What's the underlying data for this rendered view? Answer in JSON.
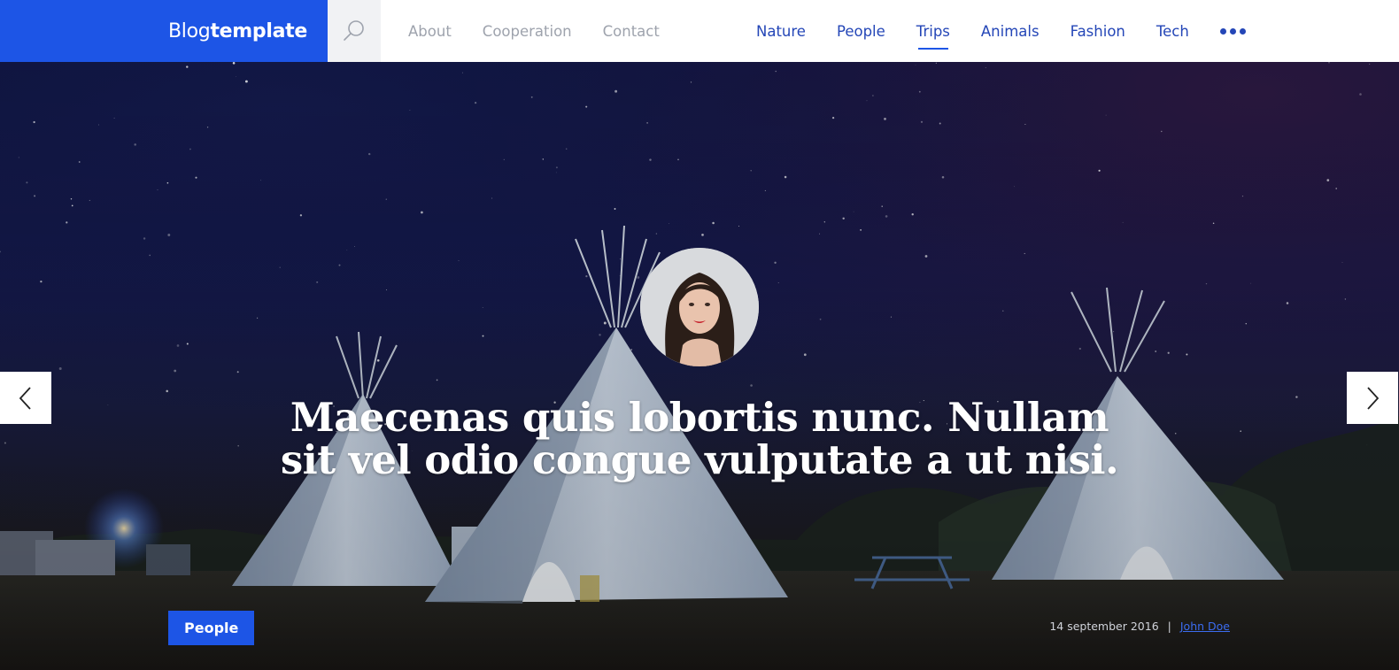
{
  "header": {
    "brand_light": "Blog",
    "brand_bold": "template",
    "colors": {
      "brand_bg": "#1d55e6",
      "nav_primary": "#2446b7",
      "nav_secondary": "#9ea3ad"
    },
    "search_icon": "search-icon",
    "nav_secondary": [
      {
        "label": "About"
      },
      {
        "label": "Cooperation"
      },
      {
        "label": "Contact"
      }
    ],
    "nav_categories": [
      {
        "label": "Nature"
      },
      {
        "label": "People"
      },
      {
        "label": "Trips",
        "active": true
      },
      {
        "label": "Animals"
      },
      {
        "label": "Fashion"
      },
      {
        "label": "Tech"
      }
    ],
    "more_icon": "more-dots-icon"
  },
  "hero": {
    "headline": "Maecenas quis lobortis nunc. Nullam sit vel odio congue vulputate a ut nisi.",
    "category": "People",
    "date": "14 september 2016",
    "separator": "|",
    "author": "John Doe",
    "prev_icon": "chevron-left-icon",
    "next_icon": "chevron-right-icon"
  }
}
